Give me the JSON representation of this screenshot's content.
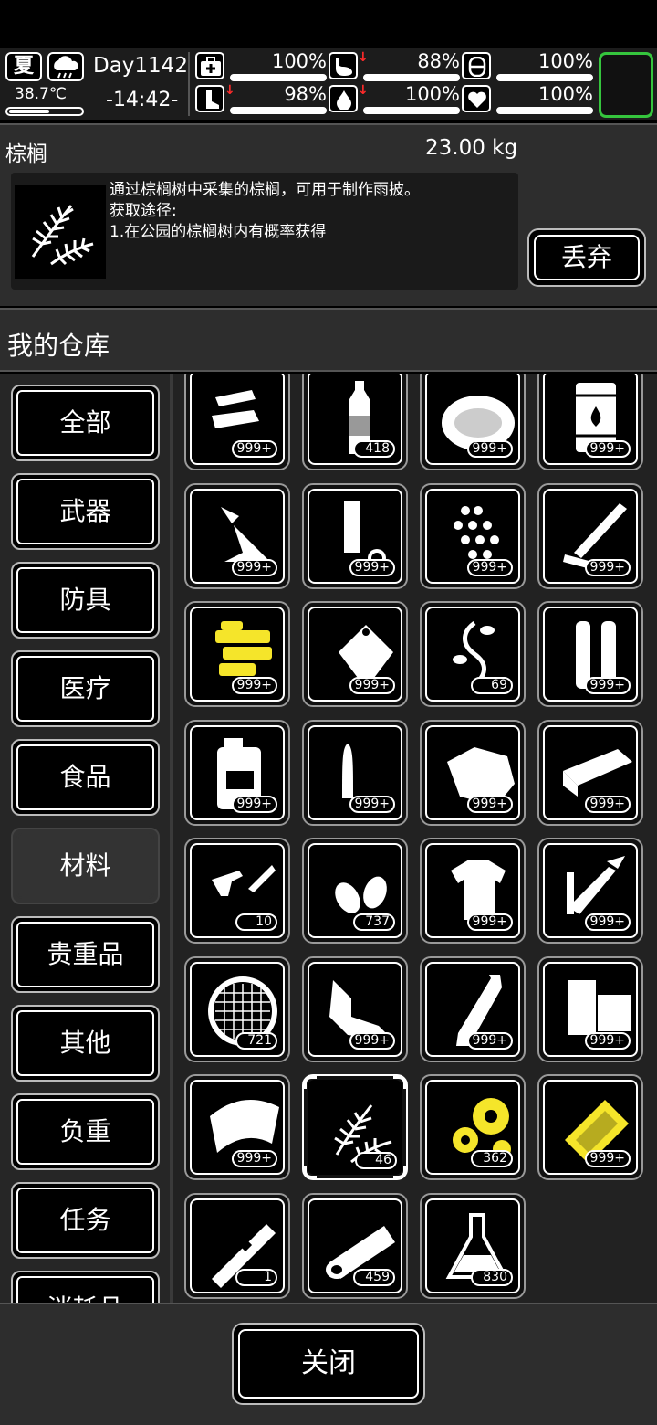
{
  "status": {
    "season": "夏",
    "weather_icon": "cloud-rain-icon",
    "temperature": "38.7℃",
    "temperature_level": 0.55,
    "day": "Day1142",
    "clock": "-14:42-",
    "stats": [
      {
        "icon": "medkit-icon",
        "value": "100%",
        "falling": false
      },
      {
        "icon": "stomach-icon",
        "value": "88%",
        "falling": true
      },
      {
        "icon": "toilet-icon",
        "value": "100%",
        "falling": false
      },
      {
        "icon": "leg-icon",
        "value": "98%",
        "falling": true
      },
      {
        "icon": "water-drop-icon",
        "value": "100%",
        "falling": true
      },
      {
        "icon": "heart-icon",
        "value": "100%",
        "falling": false
      }
    ],
    "highlight_color": "#35c53d"
  },
  "detail": {
    "name": "棕榈",
    "weight": "23.00 kg",
    "icon": "palm-leaf-icon",
    "description": "通过棕榈树中采集的棕榈，可用于制作雨披。\n获取途径:\n1.在公园的棕榈树内有概率获得",
    "discard_label": "丢弃"
  },
  "warehouse": {
    "title": "我的仓库"
  },
  "categories": [
    {
      "label": "全部",
      "active": false
    },
    {
      "label": "武器",
      "active": false
    },
    {
      "label": "防具",
      "active": false
    },
    {
      "label": "医疗",
      "active": false
    },
    {
      "label": "食品",
      "active": false
    },
    {
      "label": "材料",
      "active": true
    },
    {
      "label": "贵重品",
      "active": false
    },
    {
      "label": "其他",
      "active": false
    },
    {
      "label": "负重",
      "active": false
    },
    {
      "label": "任务",
      "active": false
    },
    {
      "label": "消耗品",
      "active": false
    }
  ],
  "items": [
    {
      "icon": "tape-rolls-icon",
      "count": "999+"
    },
    {
      "icon": "plastic-bottle-icon",
      "count": "418"
    },
    {
      "icon": "fiber-pile-icon",
      "count": "999+"
    },
    {
      "icon": "fuel-barrel-icon",
      "count": "999+"
    },
    {
      "icon": "cement-powder-icon",
      "count": "999+"
    },
    {
      "icon": "metal-pipe-icon",
      "count": "999+"
    },
    {
      "icon": "metal-balls-icon",
      "count": "999+"
    },
    {
      "icon": "wood-planks-icon",
      "count": "999+"
    },
    {
      "icon": "electronic-parts-icon",
      "count": "999+"
    },
    {
      "icon": "plastic-bag-icon",
      "count": "999+"
    },
    {
      "icon": "vine-icon",
      "count": "69"
    },
    {
      "icon": "steel-tubes-icon",
      "count": "999+"
    },
    {
      "icon": "jerry-can-icon",
      "count": "999+"
    },
    {
      "icon": "bullet-icon",
      "count": "999+"
    },
    {
      "icon": "stone-chunk-icon",
      "count": "999+"
    },
    {
      "icon": "metal-plate-icon",
      "count": "999+"
    },
    {
      "icon": "gun-parts-icon",
      "count": "10"
    },
    {
      "icon": "bullet-casings-icon",
      "count": "737"
    },
    {
      "icon": "torn-cloth-icon",
      "count": "999+"
    },
    {
      "icon": "welding-torch-icon",
      "count": "999+"
    },
    {
      "icon": "mesh-filter-icon",
      "count": "721"
    },
    {
      "icon": "scrap-metal-icon",
      "count": "999+"
    },
    {
      "icon": "glass-bottle-icon",
      "count": "999+"
    },
    {
      "icon": "wood-blocks-icon",
      "count": "999+"
    },
    {
      "icon": "plastic-sheet-icon",
      "count": "999+"
    },
    {
      "icon": "palm-leaf-icon",
      "count": "46",
      "selected": true
    },
    {
      "icon": "gears-icon",
      "count": "362"
    },
    {
      "icon": "circuit-board-icon",
      "count": "999+"
    },
    {
      "icon": "metal-rod-icon",
      "count": "1"
    },
    {
      "icon": "log-icon",
      "count": "459"
    },
    {
      "icon": "flask-icon",
      "count": "830"
    }
  ],
  "close_label": "关闭"
}
